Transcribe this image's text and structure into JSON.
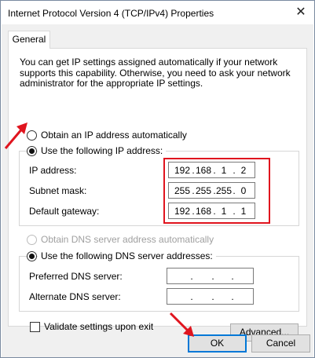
{
  "window": {
    "title": "Internet Protocol Version 4 (TCP/IPv4) Properties"
  },
  "tabs": [
    {
      "label": "General"
    }
  ],
  "description": "You can get IP settings assigned automatically if your network supports this capability. Otherwise, you need to ask your network administrator for the appropriate IP settings.",
  "ip": {
    "auto_label": "Obtain an IP address automatically",
    "manual_label": "Use the following IP address:",
    "manual_selected": true,
    "fields": [
      {
        "label": "IP address:",
        "octets": [
          "192",
          "168",
          "1",
          "2"
        ]
      },
      {
        "label": "Subnet mask:",
        "octets": [
          "255",
          "255",
          "255",
          "0"
        ]
      },
      {
        "label": "Default gateway:",
        "octets": [
          "192",
          "168",
          "1",
          "1"
        ]
      }
    ]
  },
  "dns": {
    "auto_label": "Obtain DNS server address automatically",
    "manual_label": "Use the following DNS server addresses:",
    "manual_selected": true,
    "fields": [
      {
        "label": "Preferred DNS server:",
        "octets": [
          "",
          "",
          "",
          ""
        ]
      },
      {
        "label": "Alternate DNS server:",
        "octets": [
          "",
          "",
          "",
          ""
        ]
      }
    ]
  },
  "validate_label": "Validate settings upon exit",
  "validate_checked": false,
  "buttons": {
    "advanced": "Advanced...",
    "ok": "OK",
    "cancel": "Cancel"
  },
  "colors": {
    "highlight": "#e0141e",
    "accent": "#0078d7"
  }
}
